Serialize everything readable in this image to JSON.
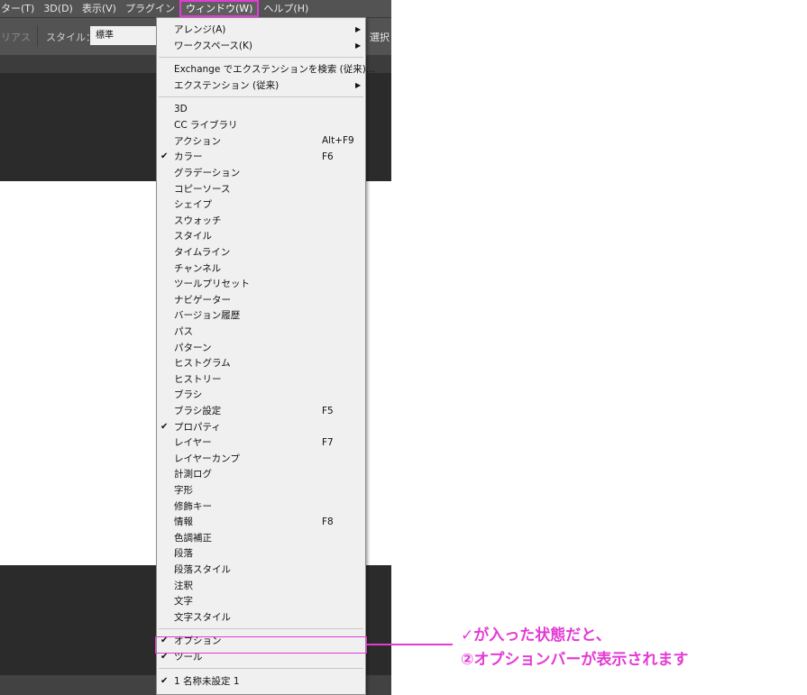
{
  "menubar": {
    "items": [
      "ター(T)",
      "3D(D)",
      "表示(V)",
      "プラグイン",
      "ウィンドウ(W)",
      "ヘルプ(H)"
    ],
    "active_index": 4
  },
  "options_bar": {
    "area_text": "リアス",
    "style_label": "スタイル：",
    "style_value": "標準",
    "select_label": "選択"
  },
  "window_menu": {
    "items": [
      {
        "label": "アレンジ(A)",
        "submenu": true
      },
      {
        "label": "ワークスペース(K)",
        "submenu": true
      },
      {
        "separator": true
      },
      {
        "label": "Exchange でエクステンションを検索 (従来)..."
      },
      {
        "label": "エクステンション (従来)",
        "submenu": true
      },
      {
        "separator": true
      },
      {
        "label": "3D"
      },
      {
        "label": "CC ライブラリ"
      },
      {
        "label": "アクション",
        "shortcut": "Alt+F9"
      },
      {
        "label": "カラー",
        "shortcut": "F6",
        "checked": true
      },
      {
        "label": "グラデーション"
      },
      {
        "label": "コピーソース"
      },
      {
        "label": "シェイプ"
      },
      {
        "label": "スウォッチ"
      },
      {
        "label": "スタイル"
      },
      {
        "label": "タイムライン"
      },
      {
        "label": "チャンネル"
      },
      {
        "label": "ツールプリセット"
      },
      {
        "label": "ナビゲーター"
      },
      {
        "label": "バージョン履歴"
      },
      {
        "label": "パス"
      },
      {
        "label": "パターン"
      },
      {
        "label": "ヒストグラム"
      },
      {
        "label": "ヒストリー"
      },
      {
        "label": "ブラシ"
      },
      {
        "label": "ブラシ設定",
        "shortcut": "F5"
      },
      {
        "label": "プロパティ",
        "checked": true
      },
      {
        "label": "レイヤー",
        "shortcut": "F7"
      },
      {
        "label": "レイヤーカンプ"
      },
      {
        "label": "計測ログ"
      },
      {
        "label": "字形"
      },
      {
        "label": "修飾キー"
      },
      {
        "label": "情報",
        "shortcut": "F8"
      },
      {
        "label": "色調補正"
      },
      {
        "label": "段落"
      },
      {
        "label": "段落スタイル"
      },
      {
        "label": "注釈"
      },
      {
        "label": "文字"
      },
      {
        "label": "文字スタイル"
      },
      {
        "separator": true
      },
      {
        "label": "オプション",
        "checked": true
      },
      {
        "label": "ツール",
        "checked": true
      },
      {
        "separator": true
      },
      {
        "label": "1 名称未設定 1",
        "checked": true
      }
    ]
  },
  "check_glyph": "✔",
  "submenu_glyph": "▶",
  "annotation": {
    "line1": "✓が入った状態だと、",
    "line2": "②オプションバーが表示されます"
  },
  "colors": {
    "accent": "#e33bd4",
    "menu_bg": "#f0f0f0",
    "app_bg": "#2b2b2b",
    "bar_bg": "#535353"
  }
}
